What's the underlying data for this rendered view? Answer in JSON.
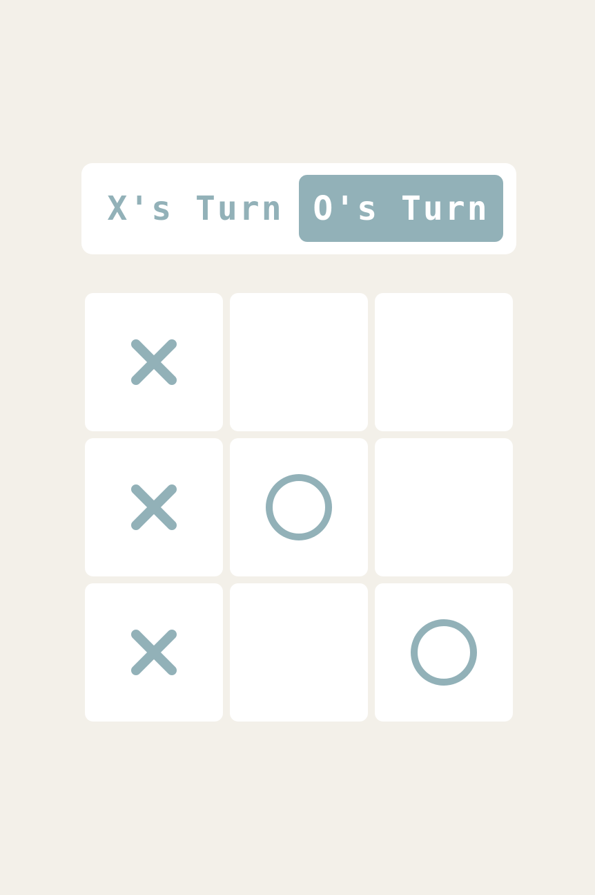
{
  "turn_toggle": {
    "x_label": "X's Turn",
    "o_label": "O's Turn",
    "active": "O"
  },
  "board": {
    "cells": [
      "X",
      "",
      "",
      "X",
      "O",
      "",
      "X",
      "",
      "O"
    ]
  },
  "colors": {
    "background": "#f3f0e9",
    "panel": "#ffffff",
    "accent": "#92b1b8",
    "active_text": "#ffffff"
  },
  "icons": {
    "X": "x-mark-icon",
    "O": "o-mark-icon"
  }
}
